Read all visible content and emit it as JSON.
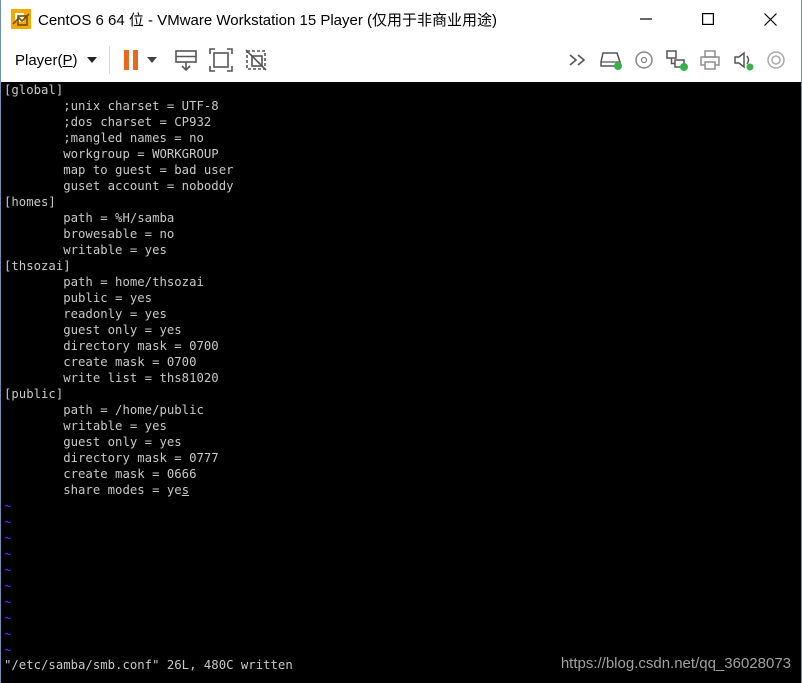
{
  "window": {
    "title": "CentOS 6 64 位 - VMware Workstation 15 Player (仅用于非商业用途)",
    "icon": "vmware-player-icon",
    "controls": [
      "minimize-icon",
      "maximize-icon",
      "close-icon"
    ]
  },
  "toolbar": {
    "player_label_prefix": "Player(",
    "player_label_hotkey": "P",
    "player_label_suffix": ")",
    "left_icons": [
      "pause-icon",
      "dropdown-caret-icon",
      "send-ctrl-alt-del-icon",
      "fit-guest-icon",
      "unity-icon"
    ],
    "right_icons": [
      "more-icon",
      "hard-disk-icon",
      "cd-dvd-icon",
      "network-adapter-icon",
      "printer-icon",
      "sound-icon",
      "usb-icon"
    ],
    "accent_pause": "#e8681e",
    "status_active": "#36b24a"
  },
  "console": {
    "lines": [
      "[global]",
      "        ;unix charset = UTF-8",
      "        ;dos charset = CP932",
      "        ;mangled names = no",
      "        workgroup = WORKGROUP",
      "        map to guest = bad user",
      "        guset account = noboddy",
      "[homes]",
      "        path = %H/samba",
      "        browesable = no",
      "        writable = yes",
      "[thsozai]",
      "        path = home/thsozai",
      "        public = yes",
      "        readonly = yes",
      "        guest only = yes",
      "        directory mask = 0700",
      "        create mask = 0700",
      "        write list = ths81020",
      "[public]",
      "        path = /home/public",
      "        writable = yes",
      "        guest only = yes",
      "        directory mask = 0777",
      "        create mask = 0666"
    ],
    "last_line_prefix": "        share modes = ye",
    "last_line_cursor_char": "s",
    "tilde_lines": [
      "~",
      "~",
      "~",
      "~",
      "~",
      "~",
      "~",
      "~",
      "~",
      "~"
    ],
    "status": "\"/etc/samba/smb.conf\" 26L, 480C written",
    "text_color": "#c8c8c8",
    "tilde_color": "#3d3df5",
    "background": "#000000"
  },
  "watermark": "https://blog.csdn.net/qq_36028073"
}
